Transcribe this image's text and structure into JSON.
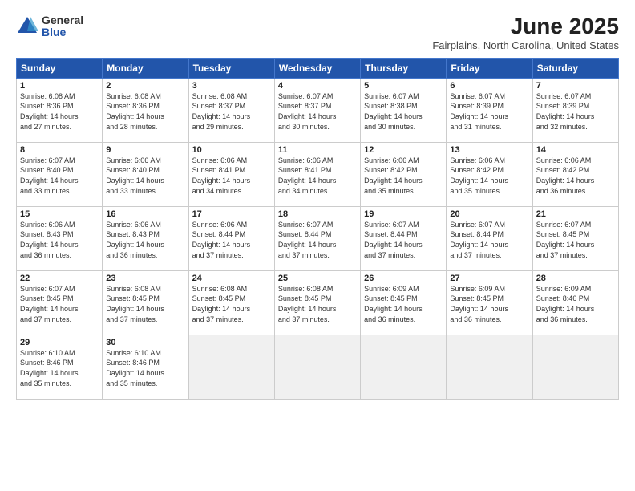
{
  "logo": {
    "general": "General",
    "blue": "Blue"
  },
  "title": {
    "month": "June 2025",
    "location": "Fairplains, North Carolina, United States"
  },
  "weekdays": [
    "Sunday",
    "Monday",
    "Tuesday",
    "Wednesday",
    "Thursday",
    "Friday",
    "Saturday"
  ],
  "weeks": [
    [
      {
        "day": "1",
        "info": "Sunrise: 6:08 AM\nSunset: 8:36 PM\nDaylight: 14 hours\nand 27 minutes."
      },
      {
        "day": "2",
        "info": "Sunrise: 6:08 AM\nSunset: 8:36 PM\nDaylight: 14 hours\nand 28 minutes."
      },
      {
        "day": "3",
        "info": "Sunrise: 6:08 AM\nSunset: 8:37 PM\nDaylight: 14 hours\nand 29 minutes."
      },
      {
        "day": "4",
        "info": "Sunrise: 6:07 AM\nSunset: 8:37 PM\nDaylight: 14 hours\nand 30 minutes."
      },
      {
        "day": "5",
        "info": "Sunrise: 6:07 AM\nSunset: 8:38 PM\nDaylight: 14 hours\nand 30 minutes."
      },
      {
        "day": "6",
        "info": "Sunrise: 6:07 AM\nSunset: 8:39 PM\nDaylight: 14 hours\nand 31 minutes."
      },
      {
        "day": "7",
        "info": "Sunrise: 6:07 AM\nSunset: 8:39 PM\nDaylight: 14 hours\nand 32 minutes."
      }
    ],
    [
      {
        "day": "8",
        "info": "Sunrise: 6:07 AM\nSunset: 8:40 PM\nDaylight: 14 hours\nand 33 minutes."
      },
      {
        "day": "9",
        "info": "Sunrise: 6:06 AM\nSunset: 8:40 PM\nDaylight: 14 hours\nand 33 minutes."
      },
      {
        "day": "10",
        "info": "Sunrise: 6:06 AM\nSunset: 8:41 PM\nDaylight: 14 hours\nand 34 minutes."
      },
      {
        "day": "11",
        "info": "Sunrise: 6:06 AM\nSunset: 8:41 PM\nDaylight: 14 hours\nand 34 minutes."
      },
      {
        "day": "12",
        "info": "Sunrise: 6:06 AM\nSunset: 8:42 PM\nDaylight: 14 hours\nand 35 minutes."
      },
      {
        "day": "13",
        "info": "Sunrise: 6:06 AM\nSunset: 8:42 PM\nDaylight: 14 hours\nand 35 minutes."
      },
      {
        "day": "14",
        "info": "Sunrise: 6:06 AM\nSunset: 8:42 PM\nDaylight: 14 hours\nand 36 minutes."
      }
    ],
    [
      {
        "day": "15",
        "info": "Sunrise: 6:06 AM\nSunset: 8:43 PM\nDaylight: 14 hours\nand 36 minutes."
      },
      {
        "day": "16",
        "info": "Sunrise: 6:06 AM\nSunset: 8:43 PM\nDaylight: 14 hours\nand 36 minutes."
      },
      {
        "day": "17",
        "info": "Sunrise: 6:06 AM\nSunset: 8:44 PM\nDaylight: 14 hours\nand 37 minutes."
      },
      {
        "day": "18",
        "info": "Sunrise: 6:07 AM\nSunset: 8:44 PM\nDaylight: 14 hours\nand 37 minutes."
      },
      {
        "day": "19",
        "info": "Sunrise: 6:07 AM\nSunset: 8:44 PM\nDaylight: 14 hours\nand 37 minutes."
      },
      {
        "day": "20",
        "info": "Sunrise: 6:07 AM\nSunset: 8:44 PM\nDaylight: 14 hours\nand 37 minutes."
      },
      {
        "day": "21",
        "info": "Sunrise: 6:07 AM\nSunset: 8:45 PM\nDaylight: 14 hours\nand 37 minutes."
      }
    ],
    [
      {
        "day": "22",
        "info": "Sunrise: 6:07 AM\nSunset: 8:45 PM\nDaylight: 14 hours\nand 37 minutes."
      },
      {
        "day": "23",
        "info": "Sunrise: 6:08 AM\nSunset: 8:45 PM\nDaylight: 14 hours\nand 37 minutes."
      },
      {
        "day": "24",
        "info": "Sunrise: 6:08 AM\nSunset: 8:45 PM\nDaylight: 14 hours\nand 37 minutes."
      },
      {
        "day": "25",
        "info": "Sunrise: 6:08 AM\nSunset: 8:45 PM\nDaylight: 14 hours\nand 37 minutes."
      },
      {
        "day": "26",
        "info": "Sunrise: 6:09 AM\nSunset: 8:45 PM\nDaylight: 14 hours\nand 36 minutes."
      },
      {
        "day": "27",
        "info": "Sunrise: 6:09 AM\nSunset: 8:45 PM\nDaylight: 14 hours\nand 36 minutes."
      },
      {
        "day": "28",
        "info": "Sunrise: 6:09 AM\nSunset: 8:46 PM\nDaylight: 14 hours\nand 36 minutes."
      }
    ],
    [
      {
        "day": "29",
        "info": "Sunrise: 6:10 AM\nSunset: 8:46 PM\nDaylight: 14 hours\nand 35 minutes."
      },
      {
        "day": "30",
        "info": "Sunrise: 6:10 AM\nSunset: 8:46 PM\nDaylight: 14 hours\nand 35 minutes."
      },
      {
        "day": "",
        "info": ""
      },
      {
        "day": "",
        "info": ""
      },
      {
        "day": "",
        "info": ""
      },
      {
        "day": "",
        "info": ""
      },
      {
        "day": "",
        "info": ""
      }
    ]
  ]
}
